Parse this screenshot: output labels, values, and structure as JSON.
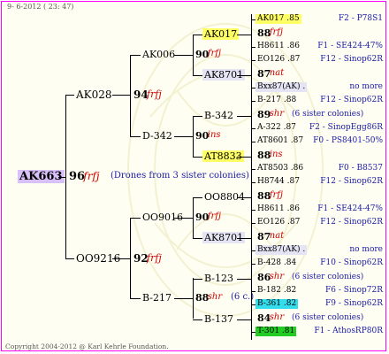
{
  "header": {
    "date": "9-  6-2012 ( 23: 47)"
  },
  "root": {
    "name": "AK663",
    "num": "96",
    "suffix": "frfj",
    "note": "(Drones from 3 sister colonies)",
    "bg": "#d8c0f8"
  },
  "left": [
    {
      "name": "AK028",
      "num": "94",
      "suffix": "frfj"
    },
    {
      "name": "OO9216",
      "num": "92",
      "suffix": "frfj"
    }
  ],
  "mid": [
    {
      "name": "AK006",
      "num": "90",
      "suffix": "frfj"
    },
    {
      "name": "D-342",
      "num": "90",
      "suffix": "ins"
    },
    {
      "name": "OO9016",
      "num": "90",
      "suffix": "frfj"
    },
    {
      "name": "B-217",
      "num": "88",
      "suffix": "shr",
      "note": "(6 c.)"
    }
  ],
  "right": [
    {
      "name": "AK017",
      "bg": "#ffff66"
    },
    {
      "name": "AK8701",
      "bg": "#e4e4f4"
    },
    {
      "name": "B-342",
      "bg": ""
    },
    {
      "name": "AT8833",
      "bg": "#ffff66"
    },
    {
      "name": "OO8804",
      "bg": ""
    },
    {
      "name": "AK8701",
      "bg": "#e4e4f4"
    },
    {
      "name": "B-123",
      "bg": ""
    },
    {
      "name": "B-137",
      "bg": ""
    }
  ],
  "groups": [
    {
      "top": {
        "name": "AK017 .85",
        "bg": "#ffff66",
        "code": "F2 - P78S1"
      },
      "num": "88",
      "suffix": "frfj",
      "note": "",
      "bottom": {
        "name": "H8611 .86",
        "bg": "",
        "code": "F1 - SE424-47%"
      }
    },
    {
      "top": {
        "name": "EO126 .87",
        "bg": "",
        "code": "F12 - Sinop62R"
      },
      "num": "87",
      "suffix": "nat",
      "note": "",
      "bottom": {
        "name": "Bxx87(AK) .",
        "bg": "#e4e4f4",
        "code": "no more"
      }
    },
    {
      "top": {
        "name": "B-217 .88",
        "bg": "",
        "code": "F12 - Sinop62R"
      },
      "num": "89",
      "suffix": "shr",
      "note": "(6 sister colonies)",
      "bottom": {
        "name": "A-322 .87",
        "bg": "",
        "code": "F2 - SinopEgg86R"
      }
    },
    {
      "top": {
        "name": "AT8601 .87",
        "bg": "",
        "code": "F0 - PS8401-50%"
      },
      "num": "88",
      "suffix": "ins",
      "note": "",
      "bottom": {
        "name": "AT8503 .86",
        "bg": "",
        "code": "F0 - B8537"
      }
    },
    {
      "top": {
        "name": "H8744 .87",
        "bg": "",
        "code": "F12 - Sinop62R"
      },
      "num": "88",
      "suffix": "frfj",
      "note": "",
      "bottom": {
        "name": "H8611 .86",
        "bg": "",
        "code": "F1 - SE424-47%"
      }
    },
    {
      "top": {
        "name": "EO126 .87",
        "bg": "",
        "code": "F12 - Sinop62R"
      },
      "num": "87",
      "suffix": "nat",
      "note": "",
      "bottom": {
        "name": "Bxx87(AK) .",
        "bg": "#e4e4f4",
        "code": "no more"
      }
    },
    {
      "top": {
        "name": "B-428 .84",
        "bg": "",
        "code": "F10 - Sinop62R"
      },
      "num": "86",
      "suffix": "shr",
      "note": "(6 sister colonies)",
      "bottom": {
        "name": "B-182 .82",
        "bg": "",
        "code": "F6 - Sinop72R"
      }
    },
    {
      "top": {
        "name": "B-361 .82",
        "bg": "#33ddee",
        "code": "F9 - Sinop62R"
      },
      "num": "84",
      "suffix": "shr",
      "note": "(6 sister colonies)",
      "bottom": {
        "name": "T-301 .81",
        "bg": "#22cc22",
        "code": "F1 - AthosRP80R"
      }
    }
  ],
  "footer": {
    "copyright": "Copyright 2004-2012 @ Karl Kehrle Foundation."
  },
  "colors": {
    "border": "#ff00ff",
    "frfj": "#d00000",
    "code": "#1a1aa8",
    "highlight_yellow": "#ffff66",
    "highlight_lavender": "#e4e4f4",
    "highlight_cyan": "#33ddee",
    "highlight_green": "#22cc22",
    "highlight_root": "#d8c0f8"
  }
}
